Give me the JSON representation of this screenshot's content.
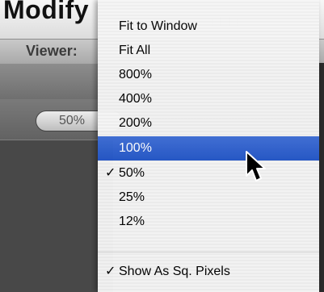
{
  "background_app": {
    "menu_title": "Modify",
    "viewer_label": "Viewer:",
    "zoom_value": "50%"
  },
  "menu": {
    "items": [
      {
        "label": "Fit to Window",
        "checked": false,
        "highlighted": false
      },
      {
        "label": "Fit All",
        "checked": false,
        "highlighted": false
      },
      {
        "label": "800%",
        "checked": false,
        "highlighted": false
      },
      {
        "label": "400%",
        "checked": false,
        "highlighted": false
      },
      {
        "label": "200%",
        "checked": false,
        "highlighted": false
      },
      {
        "label": "100%",
        "checked": false,
        "highlighted": true
      },
      {
        "label": "50%",
        "checked": true,
        "highlighted": false
      },
      {
        "label": "25%",
        "checked": false,
        "highlighted": false
      },
      {
        "label": "12%",
        "checked": false,
        "highlighted": false
      }
    ],
    "show_as_sq_pixels": {
      "label": "Show As Sq. Pixels",
      "checked": true
    },
    "check_glyph": "✓"
  },
  "colors": {
    "highlight": "#2f62d0",
    "menu_bg": "#f4f4f4"
  },
  "icons": {
    "cursor": "arrow-cursor-icon"
  }
}
